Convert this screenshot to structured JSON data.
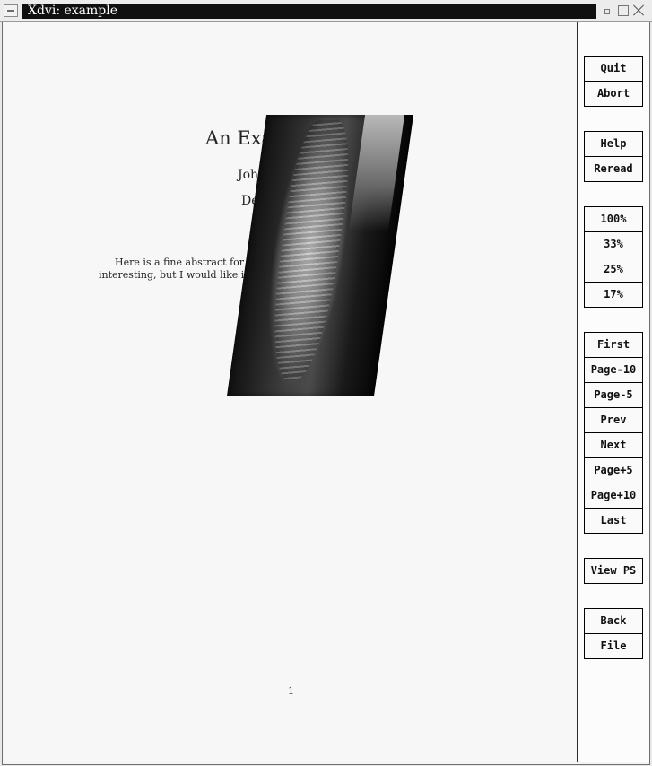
{
  "window": {
    "title": "Xdvi:  example"
  },
  "document": {
    "title": "An Exampl",
    "author": "John Q.",
    "date": "Decem",
    "abstract_line1": "Here is a fine abstract for this e                                  s not say anything",
    "abstract_line2": "interesting, but I would like it to ex                              possible.",
    "page_number": "1"
  },
  "sidebar": {
    "quit": "Quit",
    "abort": "Abort",
    "help": "Help",
    "reread": "Reread",
    "zoom_100": "100%",
    "zoom_33": "33%",
    "zoom_25": "25%",
    "zoom_17": "17%",
    "first": "First",
    "page_minus_10": "Page-10",
    "page_minus_5": "Page-5",
    "prev": "Prev",
    "next": "Next",
    "page_plus_5": "Page+5",
    "page_plus_10": "Page+10",
    "last": "Last",
    "view_ps": "View PS",
    "back": "Back",
    "file": "File"
  }
}
